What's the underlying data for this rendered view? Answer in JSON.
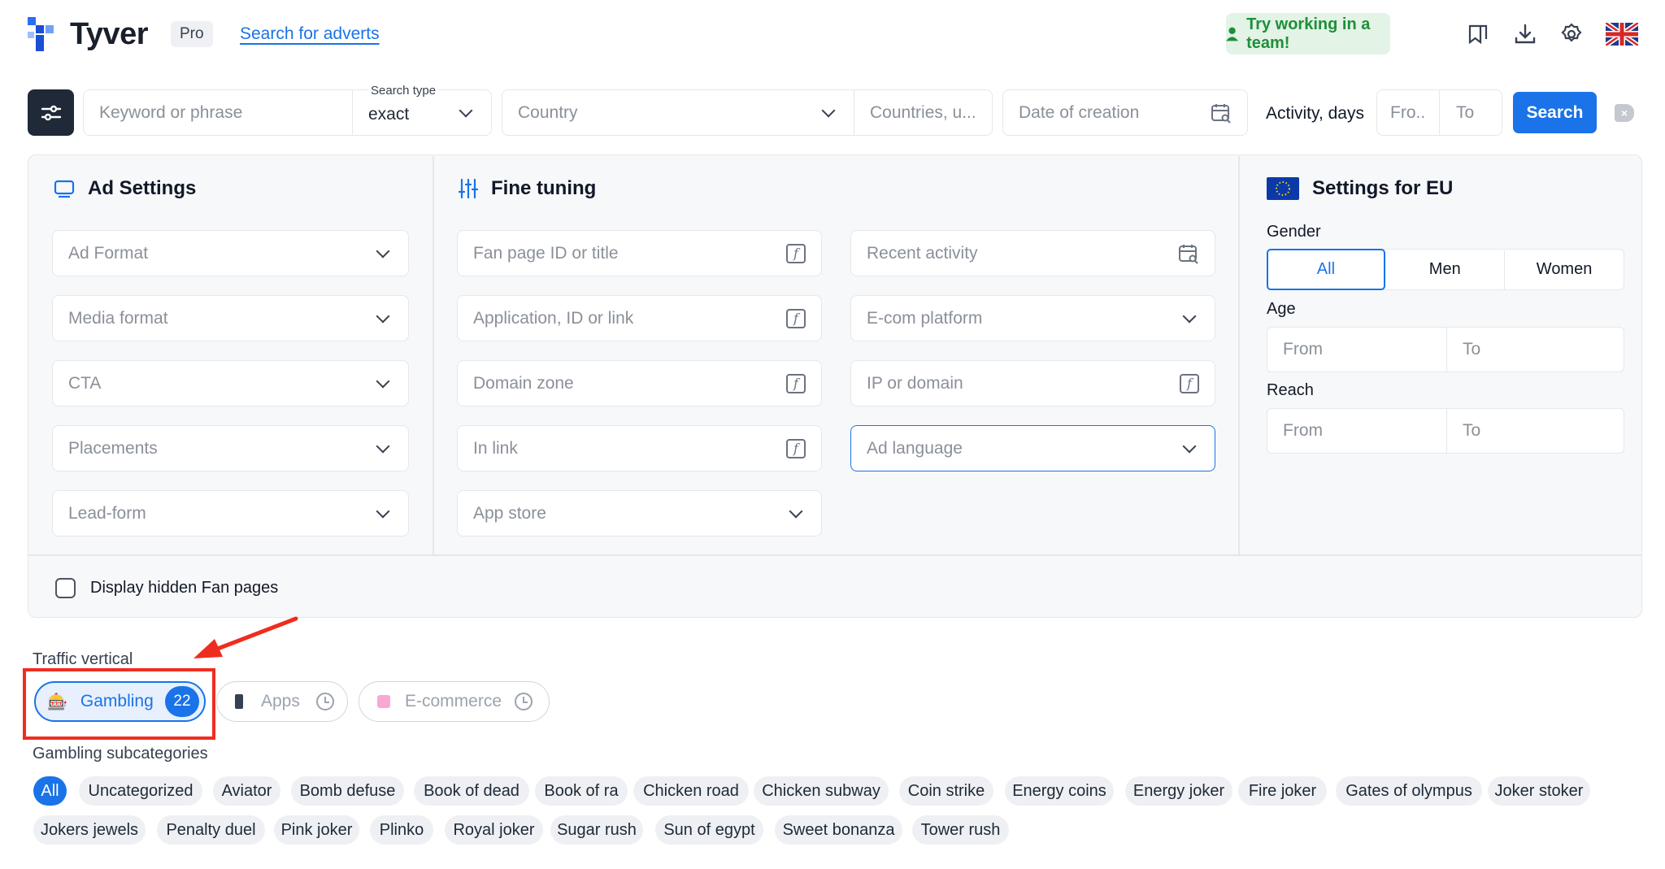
{
  "header": {
    "logo_text": "Tyver",
    "plan_badge": "Pro",
    "nav_link": "Search for adverts",
    "team_button": "Try working in a team!"
  },
  "search_bar": {
    "keyword_placeholder": "Keyword or phrase",
    "search_type_label": "Search type",
    "search_type_value": "exact",
    "country_placeholder": "Country",
    "countries_placeholder": "Countries, u...",
    "date_placeholder": "Date of creation",
    "activity_label": "Activity, days",
    "from_placeholder": "Fro...",
    "to_placeholder": "To",
    "search_button": "Search"
  },
  "ad_settings": {
    "title": "Ad Settings",
    "fields": [
      "Ad Format",
      "Media format",
      "CTA",
      "Placements",
      "Lead-form"
    ]
  },
  "fine_tuning": {
    "title": "Fine tuning",
    "left_fields": [
      "Fan page ID or title",
      "Application, ID or link",
      "Domain zone",
      "In link",
      "App store"
    ],
    "right_fields": [
      "Recent activity",
      "E-com platform",
      "IP or domain",
      "Ad language"
    ]
  },
  "eu_settings": {
    "title": "Settings for EU",
    "gender_label": "Gender",
    "gender_options": [
      "All",
      "Men",
      "Women"
    ],
    "age_label": "Age",
    "reach_label": "Reach",
    "from": "From",
    "to": "To"
  },
  "hidden_pages_label": "Display hidden Fan pages",
  "traffic_vertical": {
    "label": "Traffic vertical",
    "options": [
      {
        "label": "Gambling",
        "count": "22"
      },
      {
        "label": "Apps"
      },
      {
        "label": "E-commerce"
      }
    ]
  },
  "subcategories": {
    "label": "Gambling subcategories",
    "row1": [
      "All",
      "Uncategorized",
      "Aviator",
      "Bomb defuse",
      "Book of dead",
      "Book of ra",
      "Chicken road",
      "Chicken subway",
      "Coin strike",
      "Energy coins",
      "Energy joker",
      "Fire joker",
      "Gates of olympus",
      "Joker stoker"
    ],
    "row2": [
      "Jokers jewels",
      "Penalty duel",
      "Pink joker",
      "Plinko",
      "Royal joker",
      "Sugar rush",
      "Sun of egypt",
      "Sweet bonanza",
      "Tower rush"
    ]
  },
  "colors": {
    "accent": "#1a73e8",
    "team_bg": "#e3f3e6",
    "team_text": "#1e8f3a",
    "highlight": "#ef2d1f"
  }
}
